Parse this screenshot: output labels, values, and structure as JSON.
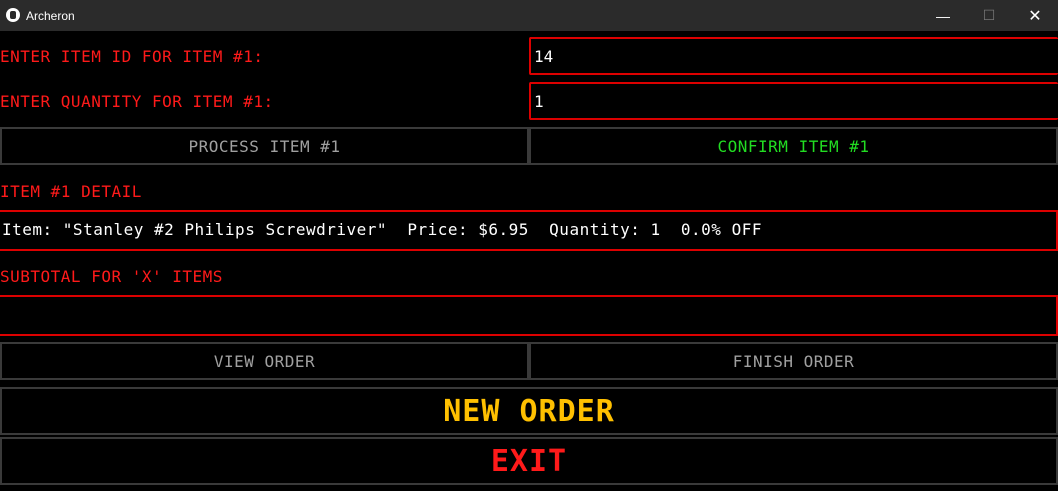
{
  "window": {
    "title": "Archeron",
    "minimize_glyph": "—",
    "maximize_glyph": "☐",
    "close_glyph": "✕"
  },
  "form": {
    "item_id_label": "ENTER ITEM ID FOR ITEM #1:",
    "item_id_value": "14",
    "quantity_label": "ENTER QUANTITY FOR ITEM #1:",
    "quantity_value": "1"
  },
  "actions": {
    "process_label": "PROCESS ITEM #1",
    "confirm_label": "CONFIRM ITEM #1"
  },
  "detail": {
    "heading": "ITEM #1 DETAIL",
    "text": "Item: \"Stanley #2 Philips Screwdriver\"  Price: $6.95  Quantity: 1  0.0% OFF"
  },
  "subtotal": {
    "heading": "SUBTOTAL FOR 'X' ITEMS",
    "value": ""
  },
  "order": {
    "view_label": "VIEW ORDER",
    "finish_label": "FINISH ORDER",
    "new_label": "NEW ORDER",
    "exit_label": "EXIT"
  },
  "colors": {
    "label_red": "#ff1a1a",
    "confirm_green": "#22dd22",
    "new_order_yellow": "#ffc000",
    "exit_red": "#ff1a1a"
  }
}
